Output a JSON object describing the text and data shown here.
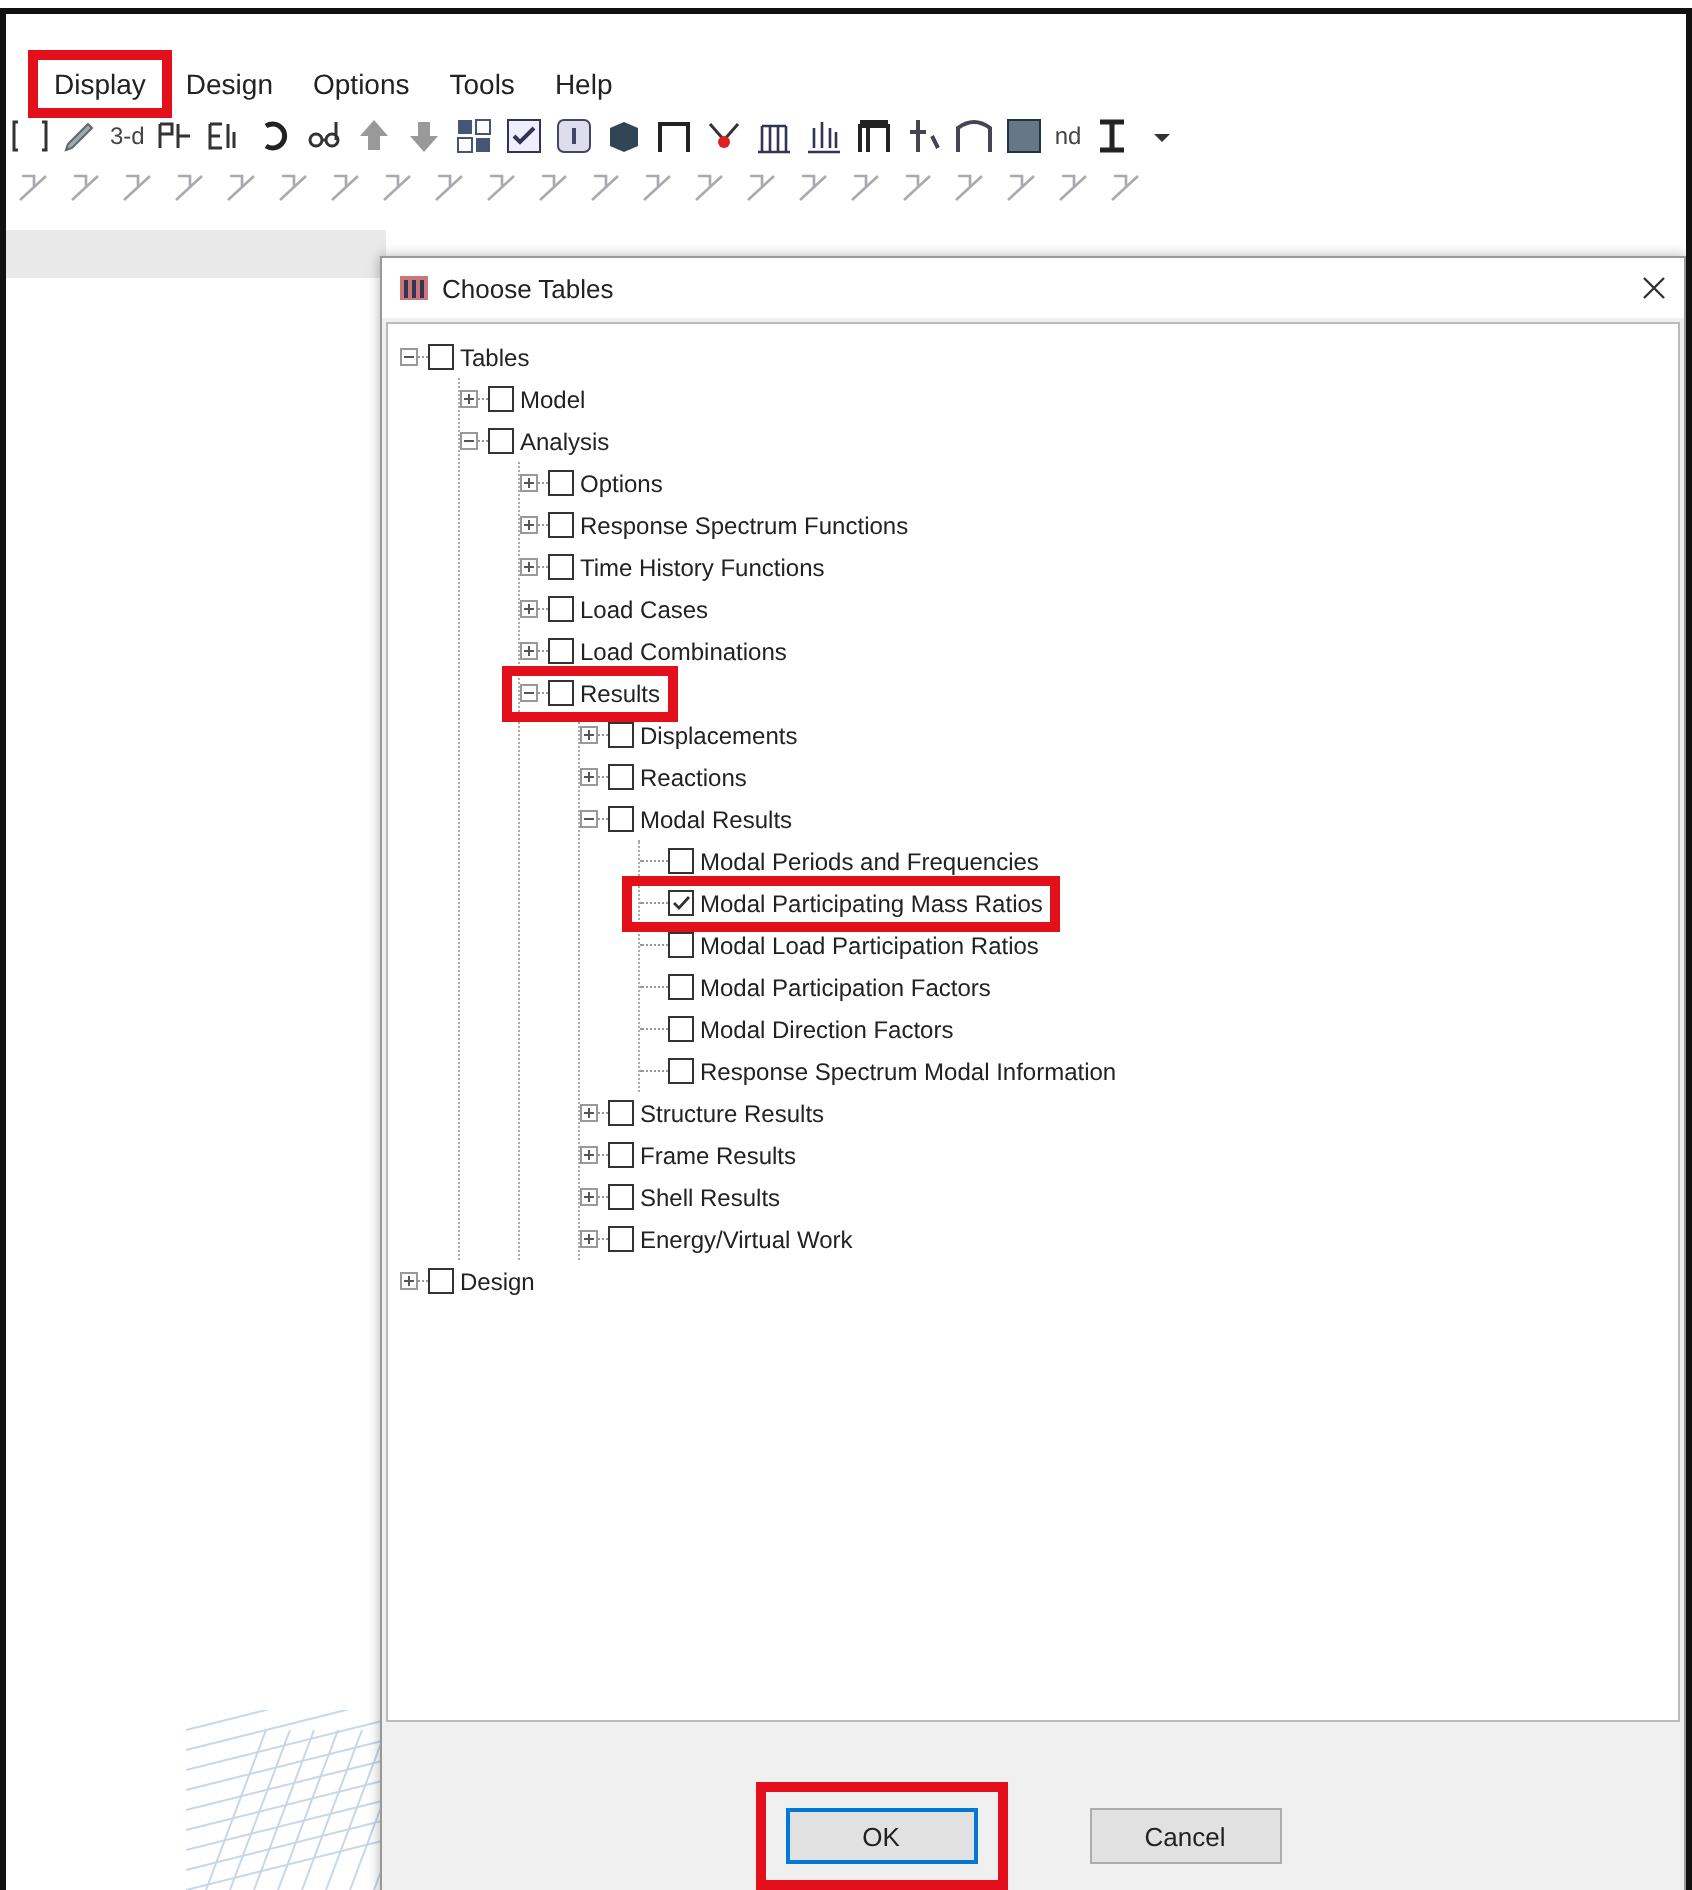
{
  "menu": [
    {
      "label": "Display",
      "highlighted": true
    },
    {
      "label": "Design",
      "highlighted": false
    },
    {
      "label": "Options",
      "highlighted": false
    },
    {
      "label": "Tools",
      "highlighted": false
    },
    {
      "label": "Help",
      "highlighted": false
    }
  ],
  "toolbar": [
    {
      "kind": "icon"
    },
    {
      "kind": "icon"
    },
    {
      "kind": "text",
      "label": "3-d"
    },
    {
      "kind": "icon"
    },
    {
      "kind": "icon"
    },
    {
      "kind": "icon"
    },
    {
      "kind": "icon"
    },
    {
      "kind": "icon"
    },
    {
      "kind": "icon"
    },
    {
      "kind": "icon"
    },
    {
      "kind": "icon"
    },
    {
      "kind": "icon"
    },
    {
      "kind": "icon"
    },
    {
      "kind": "icon"
    },
    {
      "kind": "icon"
    },
    {
      "kind": "icon"
    },
    {
      "kind": "icon"
    },
    {
      "kind": "icon"
    },
    {
      "kind": "icon"
    },
    {
      "kind": "icon"
    },
    {
      "kind": "icon"
    },
    {
      "kind": "text",
      "label": "nd"
    },
    {
      "kind": "icon"
    },
    {
      "kind": "icon"
    }
  ],
  "dialog": {
    "title": "Choose Tables",
    "tree": [
      {
        "kind": "branch",
        "label": "Tables",
        "checked": false,
        "expanded": true,
        "highlighted": false,
        "children": [
          {
            "kind": "branch",
            "label": "Model",
            "checked": false,
            "expanded": false,
            "highlighted": false
          },
          {
            "kind": "branch",
            "label": "Analysis",
            "checked": false,
            "expanded": true,
            "highlighted": false,
            "children": [
              {
                "kind": "branch",
                "label": "Options",
                "checked": false,
                "expanded": false,
                "highlighted": false
              },
              {
                "kind": "branch",
                "label": "Response Spectrum Functions",
                "checked": false,
                "expanded": false,
                "highlighted": false
              },
              {
                "kind": "branch",
                "label": "Time History Functions",
                "checked": false,
                "expanded": false,
                "highlighted": false
              },
              {
                "kind": "branch",
                "label": "Load Cases",
                "checked": false,
                "expanded": false,
                "highlighted": false
              },
              {
                "kind": "branch",
                "label": "Load Combinations",
                "checked": false,
                "expanded": false,
                "highlighted": false
              },
              {
                "kind": "branch",
                "label": "Results",
                "checked": false,
                "expanded": true,
                "highlighted": true,
                "children": [
                  {
                    "kind": "branch",
                    "label": "Displacements",
                    "checked": false,
                    "expanded": false,
                    "highlighted": false
                  },
                  {
                    "kind": "branch",
                    "label": "Reactions",
                    "checked": false,
                    "expanded": false,
                    "highlighted": false
                  },
                  {
                    "kind": "branch",
                    "label": "Modal Results",
                    "checked": false,
                    "expanded": true,
                    "highlighted": false,
                    "children": [
                      {
                        "kind": "leaf",
                        "label": "Modal Periods and Frequencies",
                        "checked": false,
                        "highlighted": false
                      },
                      {
                        "kind": "leaf",
                        "label": "Modal Participating Mass Ratios",
                        "checked": true,
                        "highlighted": true
                      },
                      {
                        "kind": "leaf",
                        "label": "Modal Load Participation Ratios",
                        "checked": false,
                        "highlighted": false
                      },
                      {
                        "kind": "leaf",
                        "label": "Modal Participation Factors",
                        "checked": false,
                        "highlighted": false
                      },
                      {
                        "kind": "leaf",
                        "label": "Modal Direction Factors",
                        "checked": false,
                        "highlighted": false
                      },
                      {
                        "kind": "leaf",
                        "label": "Response Spectrum Modal Information",
                        "checked": false,
                        "highlighted": false
                      }
                    ]
                  },
                  {
                    "kind": "branch",
                    "label": "Structure Results",
                    "checked": false,
                    "expanded": false,
                    "highlighted": false
                  },
                  {
                    "kind": "branch",
                    "label": "Frame Results",
                    "checked": false,
                    "expanded": false,
                    "highlighted": false
                  },
                  {
                    "kind": "branch",
                    "label": "Shell Results",
                    "checked": false,
                    "expanded": false,
                    "highlighted": false
                  },
                  {
                    "kind": "branch",
                    "label": "Energy/Virtual Work",
                    "checked": false,
                    "expanded": false,
                    "highlighted": false
                  }
                ]
              }
            ]
          }
        ]
      },
      {
        "kind": "branch",
        "label": "Design",
        "checked": false,
        "expanded": false,
        "highlighted": false
      }
    ],
    "buttons": [
      {
        "label": "OK",
        "highlighted": true,
        "focused": true
      },
      {
        "label": "Cancel",
        "highlighted": false,
        "focused": false
      }
    ]
  }
}
